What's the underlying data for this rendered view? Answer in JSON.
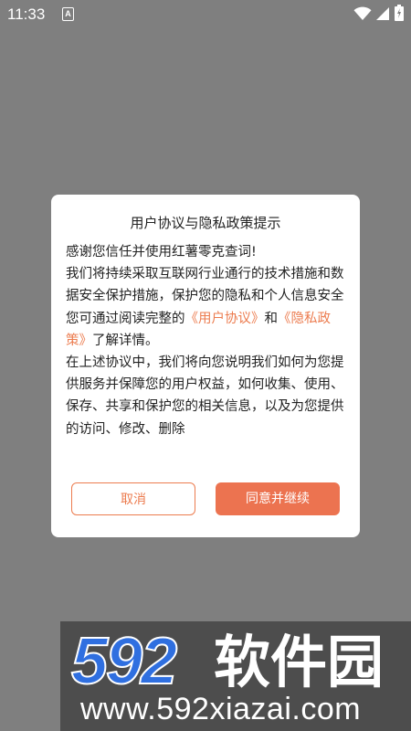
{
  "status_bar": {
    "time": "11:33",
    "icons": [
      "notification-a-icon",
      "wifi-icon",
      "signal-icon",
      "battery-icon"
    ]
  },
  "dialog": {
    "title": "用户协议与隐私政策提示",
    "greeting": "感谢您信任并使用红薯零克查词!",
    "para1_before": "我们将持续采取互联网行业通行的技术措施和数据安全保护措施，保护您的隐私和个人信息安全您可通过阅读完整的",
    "link_user_agreement": "《用户协议》",
    "and_text": "和",
    "link_privacy_policy": "《隐私政策》",
    "para1_after": "了解详情。",
    "para2": "在上述协议中，我们将向您说明我们如何为您提供服务并保障您的用户权益，如何收集、使用、保存、共享和保护您的相关信息，以及为您提供的访问、修改、删除",
    "cancel_label": "取消",
    "agree_label": "同意并继续"
  },
  "watermark": {
    "logo_text": "592软件园",
    "url": "www.592xiazai.com"
  },
  "colors": {
    "overlay": "#7f7f7f",
    "accent": "#ec7c4f",
    "accent_fill": "#ec7350",
    "logo_blue": "#2f6fe0"
  }
}
